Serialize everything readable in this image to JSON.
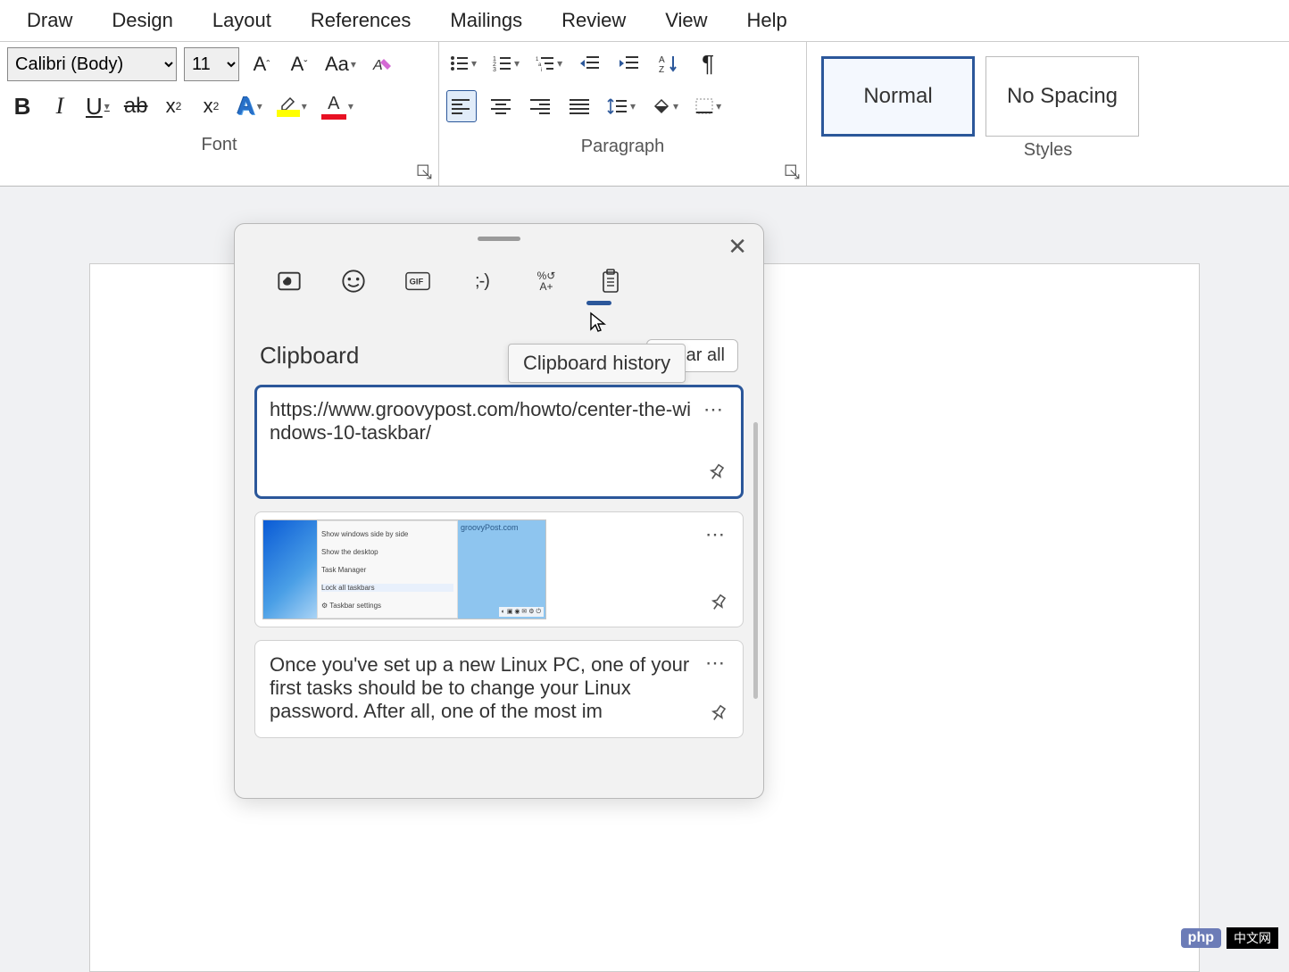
{
  "menu": {
    "items": [
      "Draw",
      "Design",
      "Layout",
      "References",
      "Mailings",
      "Review",
      "View",
      "Help"
    ]
  },
  "ribbon": {
    "font": {
      "label": "Font",
      "font_name": "Calibri (Body)",
      "font_size": "11",
      "case_label": "Aa"
    },
    "paragraph": {
      "label": "Paragraph"
    },
    "styles": {
      "label": "Styles",
      "tiles": [
        {
          "name": "Normal",
          "active": true
        },
        {
          "name": "No Spacing",
          "active": false
        }
      ]
    }
  },
  "clipboard_panel": {
    "tooltip": "Clipboard history",
    "title": "Clipboard",
    "clear_all": "Clear all",
    "items": [
      {
        "type": "text",
        "selected": true,
        "text": "https://www.groovypost.com/howto/center-the-windows-10-taskbar/"
      },
      {
        "type": "image",
        "selected": false,
        "thumb_menu": [
          "Show windows side by side",
          "Show the desktop",
          "Task Manager",
          "Lock all taskbars",
          "Taskbar settings"
        ],
        "thumb_label": "groovyPost.com"
      },
      {
        "type": "text",
        "selected": false,
        "text": "Once you've set up a new Linux PC, one of your first tasks should be to change your Linux password. After all, one of the most im"
      }
    ]
  },
  "watermark": {
    "php": "php",
    "cn": "中文网"
  }
}
